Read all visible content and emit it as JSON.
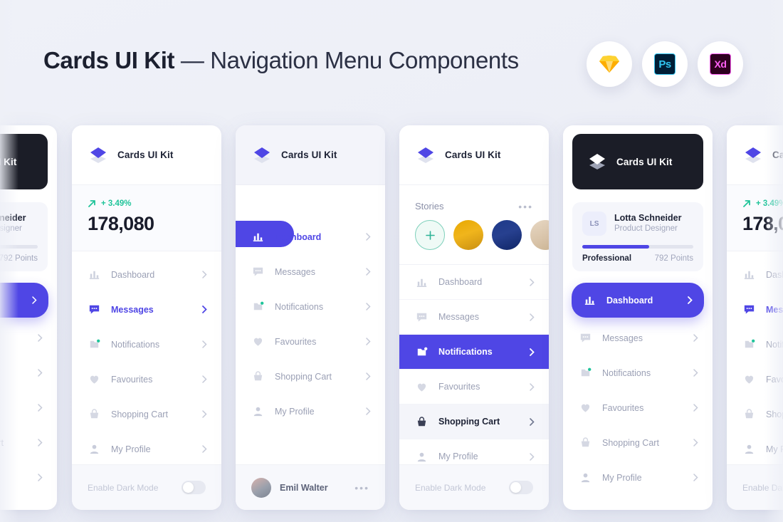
{
  "header": {
    "title_strong": "Cards UI Kit",
    "title_rest": " — Navigation Menu Components",
    "badges": [
      {
        "name": "Sketch",
        "label": ""
      },
      {
        "name": "Photoshop",
        "label": "Ps"
      },
      {
        "name": "Adobe XD",
        "label": "Xd"
      }
    ]
  },
  "brand": {
    "name": "Cards UI Kit"
  },
  "stats": {
    "trend": "+ 3.49%",
    "value": "178,080"
  },
  "profile": {
    "initials": "LS",
    "name": "Lotta Schneider",
    "role": "Product Designer",
    "level": "Professional",
    "points": "792 Points",
    "progress_percent": 60
  },
  "stories": {
    "title": "Stories",
    "more": "•••",
    "add_label": "+"
  },
  "nav": {
    "dashboard": "Dashboard",
    "messages": "Messages",
    "notifications": "Notifications",
    "favourites": "Favourites",
    "cart": "Shopping Cart",
    "profile": "My Profile"
  },
  "footer": {
    "dark_mode": "Enable Dark Mode",
    "user": "Emil Walter",
    "more": "•••"
  },
  "colors": {
    "accent": "#4f46e5",
    "green": "#20c49a",
    "dark": "#1b1d27",
    "background": "#eef0f7",
    "muted": "#9ba0b5"
  }
}
